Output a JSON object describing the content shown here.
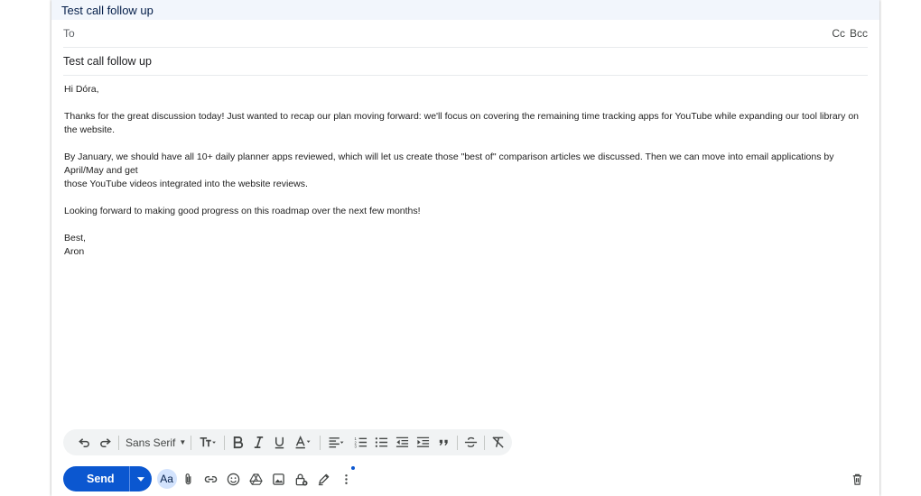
{
  "window": {
    "title": "Test call follow up"
  },
  "fields": {
    "to_label": "To",
    "cc_label": "Cc",
    "bcc_label": "Bcc",
    "subject": "Test call follow up"
  },
  "body": {
    "greeting": "Hi Dóra,",
    "paragraph1": "Thanks for the great discussion today! Just wanted to recap our plan moving forward: we'll focus on covering the remaining time tracking apps for YouTube while expanding our tool library on the website.",
    "paragraph2": "By January, we should have all 10+ daily planner apps reviewed, which will let us create those \"best of\" comparison articles we discussed. Then we can move into email applications by April/May and get\nthose YouTube videos integrated into the website reviews.",
    "paragraph3": "Looking forward to making good progress on this roadmap over the next few months!",
    "signoff": "Best,\nAron"
  },
  "formatting_toolbar": {
    "font_family": "Sans Serif"
  },
  "actions": {
    "send_label": "Send",
    "format_label": "Aa"
  },
  "colors": {
    "accent": "#0b57d0",
    "header_bg": "#f2f6fc",
    "toolbar_bg": "#f1f3f4"
  }
}
